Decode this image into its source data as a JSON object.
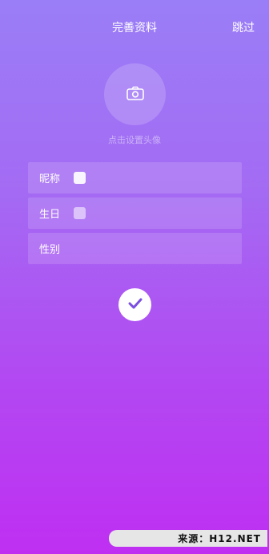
{
  "header": {
    "title": "完善资料",
    "skip_label": "跳过"
  },
  "avatar": {
    "icon": "camera-icon",
    "hint": "点击设置头像"
  },
  "form": {
    "fields": [
      {
        "label": "昵称"
      },
      {
        "label": "生日"
      },
      {
        "label": "性别"
      }
    ]
  },
  "confirm": {
    "icon": "checkmark-icon"
  },
  "watermark": {
    "text": "来源：H12.NET"
  },
  "colors": {
    "gradient_top": "#9a7ef7",
    "gradient_bottom": "#bf2ff2",
    "accent": "#7b4fe0"
  }
}
